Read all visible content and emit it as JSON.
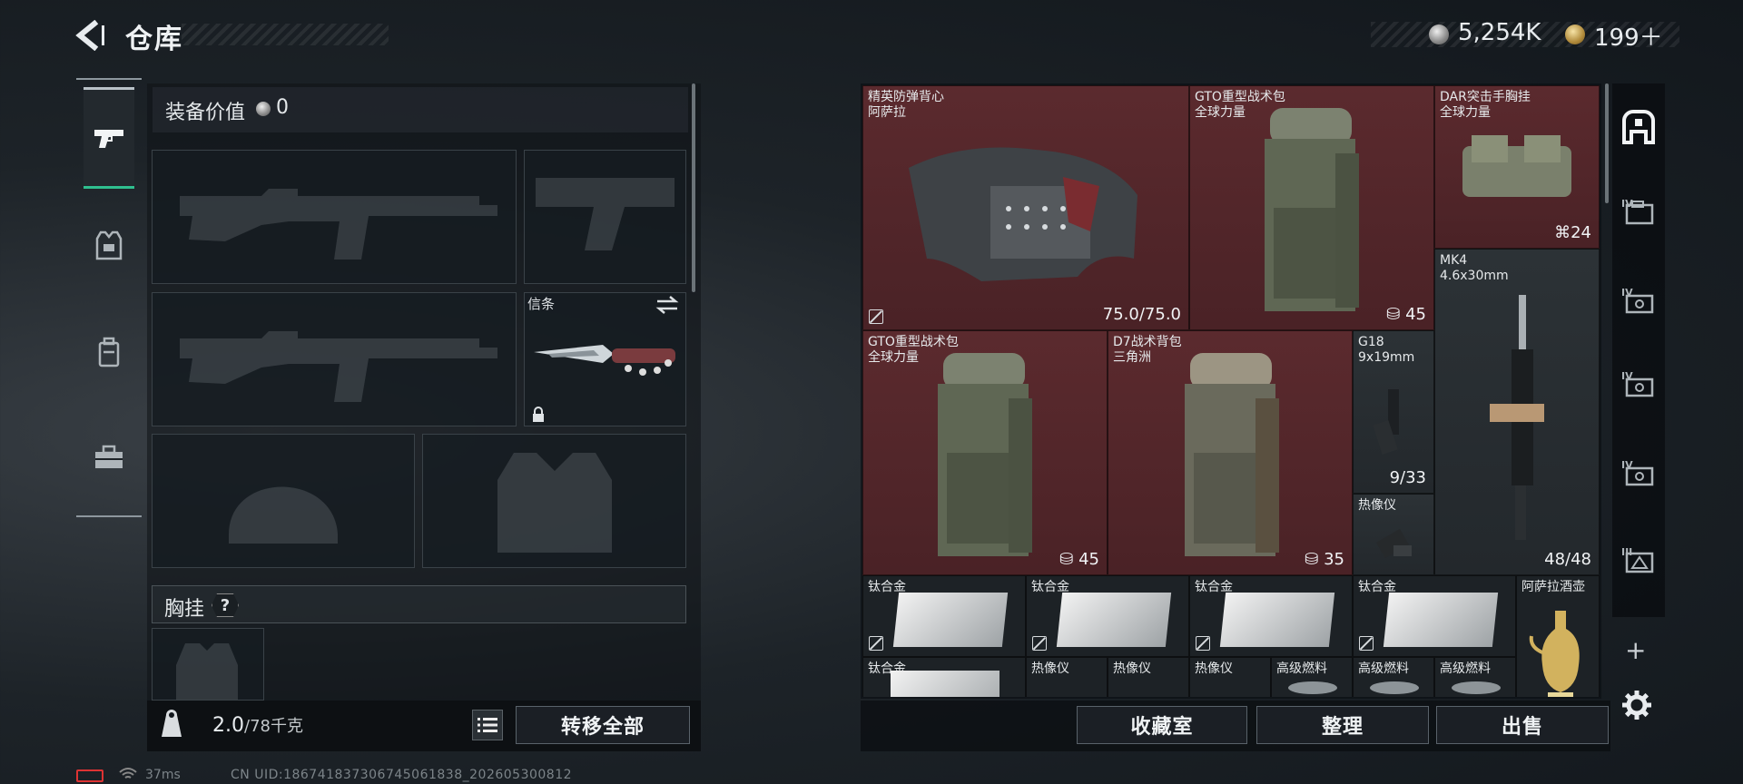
{
  "header": {
    "title": "仓库",
    "currency_silver": "5,254K",
    "currency_gold": "199＋"
  },
  "loadout": {
    "equipment_value_label": "装备价值",
    "equipment_value": "0",
    "melee_label": "信条",
    "chest_rig_label": "胸挂",
    "chest_rig_help": "?",
    "weight_current": "2.0",
    "weight_max": "/78千克",
    "transfer_all": "转移全部"
  },
  "storage": {
    "items": [
      {
        "name": "精英防弹背心",
        "sub": "阿萨拉",
        "count": "75.0/75.0"
      },
      {
        "name": "GTO重型战术包",
        "sub": "全球力量",
        "count": "45"
      },
      {
        "name": "DAR突击手胸挂",
        "sub": "全球力量",
        "count": "24"
      },
      {
        "name": "MK4",
        "sub": "4.6x30mm",
        "count": "48/48"
      },
      {
        "name": "GTO重型战术包",
        "sub": "全球力量",
        "count": "45"
      },
      {
        "name": "D7战术背包",
        "sub": "三角洲",
        "count": "35"
      },
      {
        "name": "G18",
        "sub": "9x19mm",
        "count": "9/33"
      },
      {
        "name": "热像仪"
      },
      {
        "name": "钛合金"
      },
      {
        "name": "钛合金"
      },
      {
        "name": "钛合金"
      },
      {
        "name": "钛合金"
      },
      {
        "name": "阿萨拉酒壶"
      },
      {
        "name": "钛合金"
      },
      {
        "name": "热像仪"
      },
      {
        "name": "热像仪"
      },
      {
        "name": "热像仪"
      },
      {
        "name": "高级燃料"
      },
      {
        "name": "高级燃料"
      },
      {
        "name": "高级燃料"
      }
    ]
  },
  "buttons": {
    "collection": "收藏室",
    "sort": "整理",
    "sell": "出售"
  },
  "right_sidebar": {
    "tab_labels": [
      "IV",
      "IV",
      "IV",
      "IV",
      "III"
    ],
    "add": "+"
  },
  "status": {
    "ping": "37ms",
    "uid": "CN UID:186741837306745061838_202605300812"
  },
  "colors": {
    "accent_green": "#2fbf8f",
    "rare_red": "#5b2a2e",
    "battery_red": "#dd3333"
  },
  "icons": [
    "back-arrow-icon",
    "silver-coin-icon",
    "gold-coin-icon",
    "pistol-icon",
    "armor-icon",
    "backpack-icon",
    "toolbox-icon",
    "lock-icon",
    "swap-icon",
    "weight-icon",
    "list-icon",
    "storage-home-icon",
    "case-icon",
    "gear-icon",
    "plus-icon",
    "info-icon",
    "durability-icon"
  ]
}
